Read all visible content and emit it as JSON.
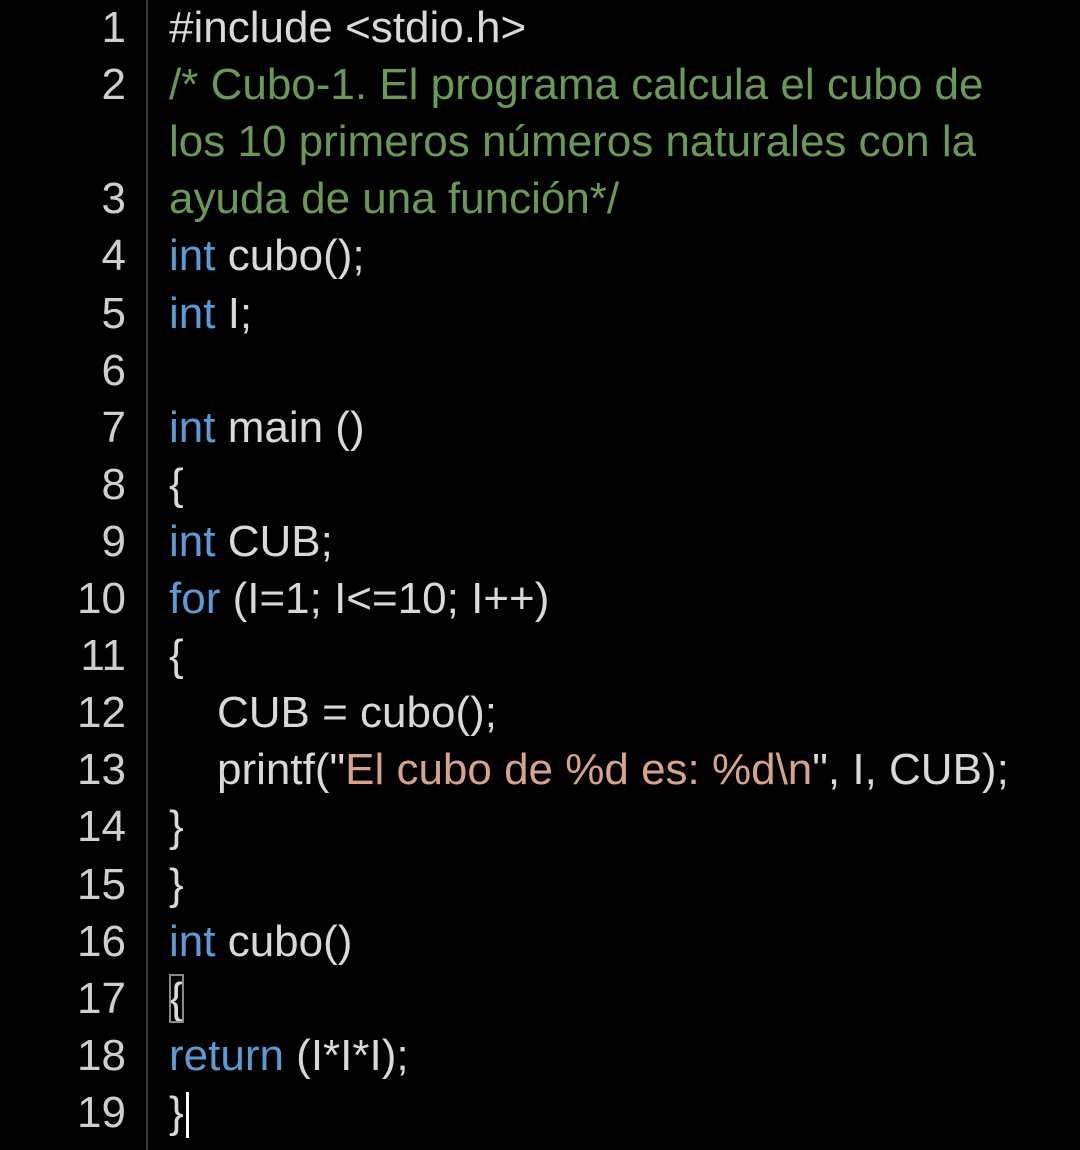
{
  "colors": {
    "background": "#000000",
    "line_number": "#cfcfcf",
    "keyword": "#5b9bd5",
    "comment": "#6a9955",
    "string": "#d7a38a",
    "text": "#d9d9d9"
  },
  "lines": [
    {
      "num": "1",
      "parts": [
        {
          "t": "#include <stdio.h>",
          "c": "txt"
        }
      ]
    },
    {
      "num": "2",
      "parts": [
        {
          "t": "/* Cubo-1. El programa calcula el cubo de",
          "c": "cmt"
        }
      ]
    },
    {
      "num": "",
      "parts": [
        {
          "t": "los 10 primeros números naturales con la",
          "c": "cmt"
        }
      ]
    },
    {
      "num": "3",
      "parts": [
        {
          "t": "ayuda de una función*/",
          "c": "cmt"
        }
      ]
    },
    {
      "num": "4",
      "parts": [
        {
          "t": "int",
          "c": "kw"
        },
        {
          "t": " cubo();",
          "c": "txt"
        }
      ]
    },
    {
      "num": "5",
      "parts": [
        {
          "t": "int",
          "c": "kw"
        },
        {
          "t": " I;",
          "c": "txt"
        }
      ]
    },
    {
      "num": "6",
      "parts": []
    },
    {
      "num": "7",
      "parts": [
        {
          "t": "int",
          "c": "kw"
        },
        {
          "t": " main ()",
          "c": "txt"
        }
      ]
    },
    {
      "num": "8",
      "parts": [
        {
          "t": "{",
          "c": "txt"
        }
      ]
    },
    {
      "num": "9",
      "parts": [
        {
          "t": "int",
          "c": "kw"
        },
        {
          "t": " CUB;",
          "c": "txt"
        }
      ]
    },
    {
      "num": "10",
      "parts": [
        {
          "t": "for",
          "c": "kw"
        },
        {
          "t": " (I=1; I<=10; I++)",
          "c": "txt"
        }
      ]
    },
    {
      "num": "11",
      "parts": [
        {
          "t": "{",
          "c": "txt"
        }
      ]
    },
    {
      "num": "12",
      "indent": true,
      "parts": [
        {
          "t": "CUB = cubo();",
          "c": "txt"
        }
      ]
    },
    {
      "num": "13",
      "indent": true,
      "parts": [
        {
          "t": "printf(\"",
          "c": "txt"
        },
        {
          "t": "El cubo de %d es: %d\\n",
          "c": "str"
        },
        {
          "t": "\", I, CUB);",
          "c": "txt"
        }
      ]
    },
    {
      "num": "14",
      "parts": [
        {
          "t": "}",
          "c": "txt"
        }
      ]
    },
    {
      "num": "15",
      "parts": [
        {
          "t": "}",
          "c": "txt"
        }
      ]
    },
    {
      "num": "16",
      "parts": [
        {
          "t": "int",
          "c": "kw"
        },
        {
          "t": " cubo()",
          "c": "txt"
        }
      ]
    },
    {
      "num": "17",
      "parts": [
        {
          "t": "{",
          "c": "txt",
          "match": true
        }
      ]
    },
    {
      "num": "18",
      "parts": [
        {
          "t": "return",
          "c": "kw"
        },
        {
          "t": " (I*I*I);",
          "c": "txt"
        }
      ]
    },
    {
      "num": "19",
      "cursor": true,
      "parts": [
        {
          "t": "}",
          "c": "txt"
        }
      ]
    }
  ]
}
